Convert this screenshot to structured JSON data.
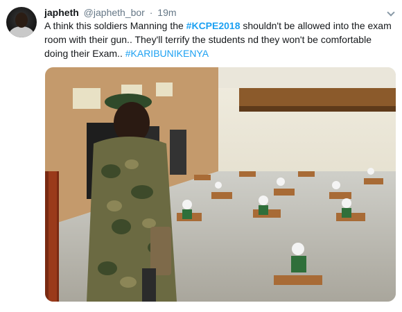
{
  "user": {
    "name": "japheth",
    "handle": "@japheth_bor",
    "separator": "·",
    "time": "19m"
  },
  "tweet": {
    "text_1": "A think this soldiers Manning the ",
    "hashtag_1": "#KCPE2018",
    "text_2": " shouldn't be allowed into the exam room with their gun.. They'll terrify the students nd they won't be comfortable doing their Exam.. ",
    "hashtag_2": "#KARIBUNIKENYA"
  },
  "icons": {
    "menu": "chevron-down-icon",
    "avatar": "user-avatar"
  },
  "colors": {
    "link": "#1da1f2",
    "secondary_text": "#657786",
    "primary_text": "#14171a"
  }
}
